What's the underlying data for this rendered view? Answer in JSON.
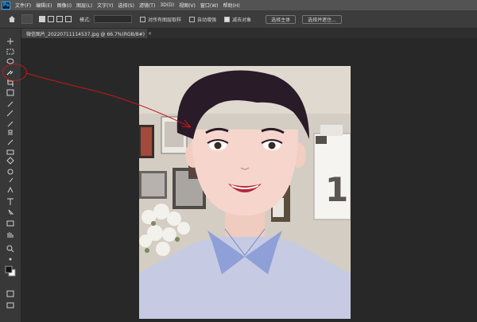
{
  "app": {
    "logo": "Ps"
  },
  "menu": [
    "文件(F)",
    "编辑(E)",
    "图像(I)",
    "图层(L)",
    "文字(Y)",
    "选择(S)",
    "滤镜(T)",
    "3D(D)",
    "视图(V)",
    "窗口(W)",
    "帮助(H)"
  ],
  "options": {
    "mode_label": "模式:",
    "mode_value": "",
    "sample_all_layers": "对所有图层取样",
    "auto_enhance": "自动增强",
    "subtract_target": "减去对象",
    "select_subject": "选择主体",
    "select_and_mask": "选择并遮住..."
  },
  "document": {
    "tab_title": "微信图片_20220711114537.jpg @ 66.7%(RGB/8#)",
    "close_glyph": "×"
  },
  "photo": {
    "calendar_number": "1"
  },
  "colors": {
    "accent": "#31a8ff",
    "annotation": "#c0191c",
    "shirt": "#c6cbe3",
    "collar": "#8f9fd7",
    "hair": "#2a1b28",
    "skin": "#f6d6cc"
  }
}
